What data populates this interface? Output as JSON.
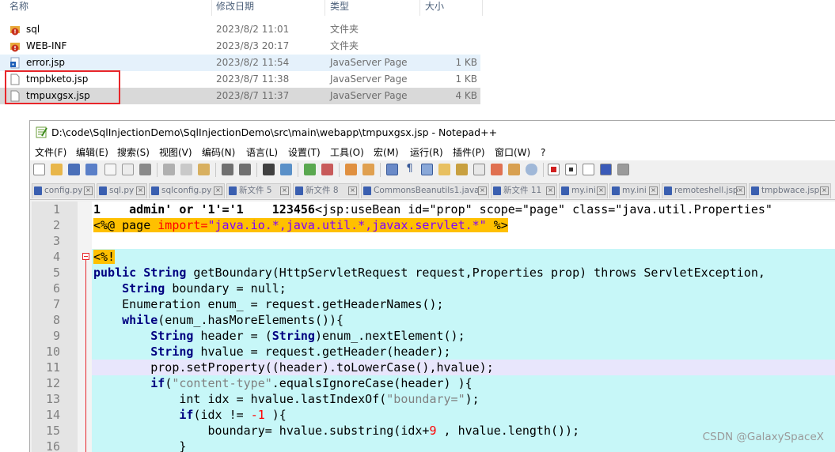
{
  "explorer": {
    "columns": {
      "name": "名称",
      "date": "修改日期",
      "type": "类型",
      "size": "大小"
    },
    "files": [
      {
        "name": "sql",
        "date": "2023/8/2 11:01",
        "type": "文件夹",
        "size": "",
        "icon": "folder-warning-icon"
      },
      {
        "name": "WEB-INF",
        "date": "2023/8/3 20:17",
        "type": "文件夹",
        "size": "",
        "icon": "folder-warning-icon"
      },
      {
        "name": "error.jsp",
        "date": "2023/8/2 11:54",
        "type": "JavaServer Page",
        "size": "1 KB",
        "icon": "jsp-file-icon"
      },
      {
        "name": "tmpbketo.jsp",
        "date": "2023/8/7 11:38",
        "type": "JavaServer Page",
        "size": "1 KB",
        "icon": "blank-file-icon"
      },
      {
        "name": "tmpuxgsx.jsp",
        "date": "2023/8/7 11:37",
        "type": "JavaServer Page",
        "size": "4 KB",
        "icon": "blank-file-icon"
      }
    ]
  },
  "notepad": {
    "title": "D:\\code\\SqlInjectionDemo\\SqlInjectionDemo\\src\\main\\webapp\\tmpuxgsx.jsp - Notepad++",
    "menu": [
      "文件(F)",
      "编辑(E)",
      "搜索(S)",
      "视图(V)",
      "编码(N)",
      "语言(L)",
      "设置(T)",
      "工具(O)",
      "宏(M)",
      "运行(R)",
      "插件(P)",
      "窗口(W)",
      "?"
    ],
    "tabs": [
      "config.py",
      "sql.py",
      "sqlconfig.py",
      "新文件 5",
      "新文件 8",
      "CommonsBeanutils1.java",
      "新文件 11",
      "my.ini",
      "my.ini",
      "remoteshell.jsp",
      "tmpbwace.jsp"
    ],
    "line_numbers": [
      "1",
      "2",
      "3",
      "4",
      "5",
      "6",
      "7",
      "8",
      "9",
      "10",
      "11",
      "12",
      "13",
      "14",
      "15",
      "16"
    ]
  },
  "code": {
    "l1a": "1    admin' or '1'='1    123456",
    "l1b": "<jsp:useBean id=\"prop\" scope=\"page\" class=\"java.util.Properties\"",
    "l2_open": "<%@",
    "l2_page": " page ",
    "l2_import": "import=",
    "l2_val": "\"java.io.*,java.util.*,javax.servlet.*\"",
    "l2_close": " %>",
    "l4": "<%!",
    "l5a": "public",
    "l5b": "String",
    "l5c": " getBoundary(HttpServletRequest request,Properties prop) throws ServletException,",
    "l6a": "String",
    "l6b": " boundary = null;",
    "l7": "Enumeration enum_ = request.getHeaderNames();",
    "l8a": "while",
    "l8b": "(enum_.hasMoreElements()){",
    "l9a": "String",
    "l9b": " header = (",
    "l9c": "String",
    "l9d": ")enum_.nextElement();",
    "l10a": "String",
    "l10b": " hvalue = request.getHeader(header);",
    "l11": "prop.setProperty((header).toLowerCase(),hvalue);",
    "l12a": "if",
    "l12b": "(",
    "l12c": "\"content-type\"",
    "l12d": ".equalsIgnoreCase(header) ){",
    "l13a": "int idx = hvalue.lastIndexOf(",
    "l13b": "\"boundary=\"",
    "l13c": ");",
    "l14a": "if",
    "l14b": "(idx != ",
    "l14c": "-1",
    "l14d": " ){",
    "l15a": "boundary= hvalue.substring(idx+",
    "l15b": "9",
    "l15c": " , hvalue.length());",
    "l16": "}"
  },
  "watermark": "CSDN @GalaxySpaceX",
  "colors": {
    "highlight_line": "#c7f7f8",
    "current_line": "#e8e6fc",
    "tag_bg": "#ffc000",
    "annotation_box": "#e8262a"
  }
}
